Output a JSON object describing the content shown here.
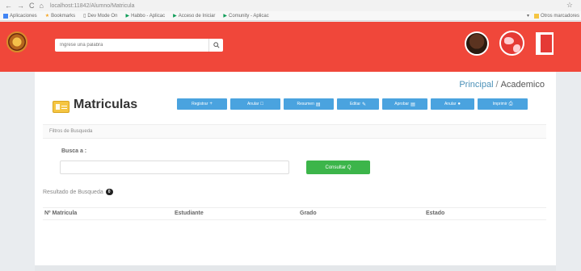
{
  "browser": {
    "url": "localhost:11842/Alumno/Matricula",
    "bookmarks": [
      "Aplicaciones",
      "Bookmarks",
      "Dev Mode On",
      "Habbo - Aplicac",
      "Acceso de Iniciar",
      "Comunity - Aplicac"
    ],
    "other_bookmarks": "Otros marcadores"
  },
  "header": {
    "search_placeholder": "Ingrese una palabra"
  },
  "breadcrumb": {
    "parent": "Principal",
    "separator": "/",
    "current": "Academico"
  },
  "page": {
    "title": "Matriculas"
  },
  "toolbar": {
    "buttons": [
      {
        "label": "Registrar",
        "icon": "+"
      },
      {
        "label": "Anular",
        "icon": "□"
      },
      {
        "label": "Resumen",
        "icon": "▤"
      },
      {
        "label": "Editar",
        "icon": "✎"
      },
      {
        "label": "Aprobar",
        "icon": "▤"
      },
      {
        "label": "Anular",
        "icon": "●"
      },
      {
        "label": "Imprimir",
        "icon": "⎙"
      }
    ]
  },
  "filters": {
    "section_title": "Filtros de Busqueda",
    "busca_label": "Busca a :",
    "consultar_label": "Consultar",
    "consultar_icon": "Q"
  },
  "results": {
    "section_title": "Resultado de Busqueda",
    "count": "0",
    "columns": [
      "Nº Matricula",
      "Estudiante",
      "Grado",
      "Estado"
    ]
  },
  "colors": {
    "header_red": "#f0473a",
    "toolbar_blue": "#4aa3df",
    "consultar_green": "#3cb54a"
  }
}
